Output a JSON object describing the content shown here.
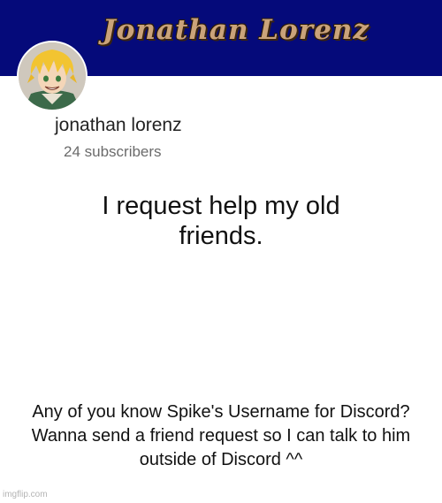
{
  "banner": {
    "title": "Jonathan Lorenz",
    "background_color": "#050a7a",
    "title_color": "#caa37a"
  },
  "channel": {
    "avatar_icon": "anime-character-avatar",
    "name": "jonathan lorenz",
    "subscribers": "24 subscribers"
  },
  "post": {
    "headline": "I request help my old friends.",
    "caption": "Any of you know Spike's Username for Discord? Wanna send a friend request so I can talk to him outside of Discord ^^"
  },
  "watermark": {
    "text": "imgflip.com"
  }
}
